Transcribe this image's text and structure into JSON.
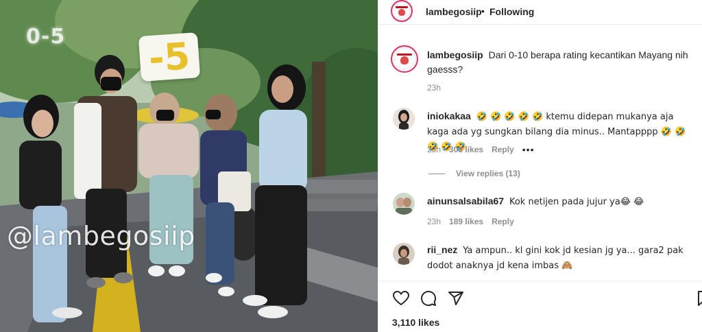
{
  "media": {
    "sticker_small": "0-5",
    "sticker_big": "-5",
    "watermark": "@lambegosiip"
  },
  "post": {
    "username": "lambegosiip",
    "separator": "•",
    "follow_status": "Following",
    "caption": {
      "username": "lambegosiip",
      "text": "Dari 0-10 berapa rating kecantikan Mayang nih gaesss?",
      "time": "23h"
    },
    "comments": [
      {
        "username": "iniokakaa",
        "text": "🤣 🤣 🤣 🤣 🤣 ktemu didepan mukanya aja kaga ada yg sungkan bilang dia minus.. Mantapppp 🤣 🤣 🤣 🤣 🤣",
        "time": "23h",
        "likes": "303 likes",
        "reply": "Reply",
        "more": "•••",
        "view_replies": "View replies (13)"
      },
      {
        "username": "ainunsalsabila67",
        "text": "Kok netijen pada jujur ya😂 😂",
        "time": "23h",
        "likes": "189 likes",
        "reply": "Reply"
      },
      {
        "username": "rii_nez",
        "text": "Ya ampun.. kl gini kok jd kesian jg ya... gara2 pak dodot anaknya jd kena imbas 🙈"
      }
    ],
    "likes_count": "3,110 likes"
  },
  "icons": [
    "heart-icon",
    "comment-icon",
    "share-icon",
    "bookmark-icon"
  ],
  "colors": {
    "text": "#262626",
    "muted": "#8e8e8e",
    "border": "#efefef",
    "story_ring": "#d6336c"
  }
}
